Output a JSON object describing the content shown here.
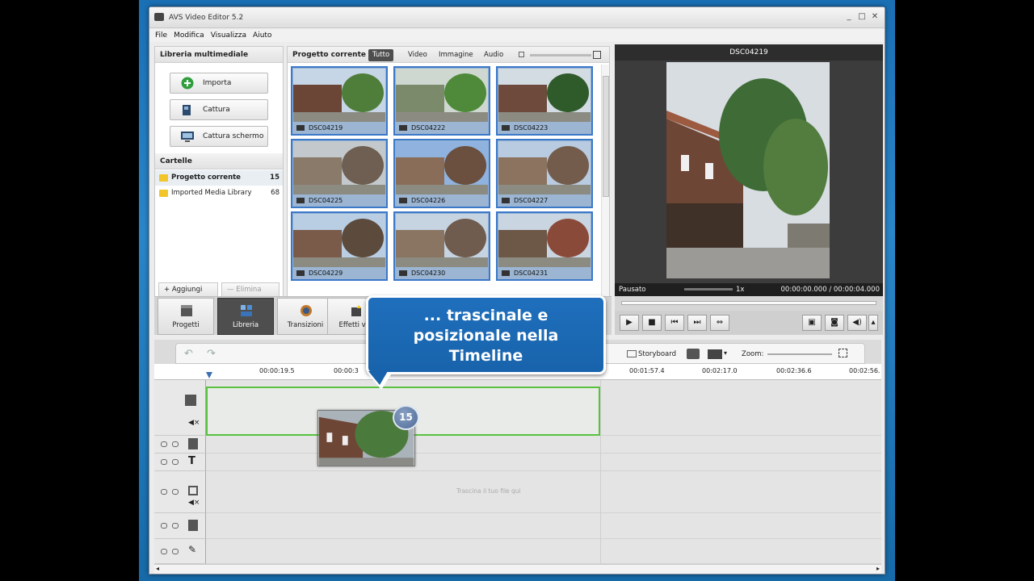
{
  "window": {
    "title": "AVS Video Editor 5.2",
    "controls": [
      "_",
      "□",
      "✕"
    ]
  },
  "menu": [
    "File",
    "Modifica",
    "Visualizza",
    "Aiuto"
  ],
  "library": {
    "title": "Libreria multimediale",
    "buttons": [
      "Importa",
      "Cattura",
      "Cattura schermo"
    ],
    "folders_title": "Cartelle",
    "folders": [
      {
        "label": "Progetto corrente",
        "count": "15"
      },
      {
        "label": "Imported Media Library",
        "count": "68"
      }
    ],
    "add_label": "+ Aggiungi",
    "remove_label": "— Elimina"
  },
  "media": {
    "title": "Progetto corrente",
    "filters": [
      "Tutto",
      "Video",
      "Immagine",
      "Audio"
    ],
    "items": [
      "DSC04219",
      "DSC04222",
      "DSC04223",
      "DSC04225",
      "DSC04226",
      "DSC04227",
      "DSC04229",
      "DSC04230",
      "DSC04231"
    ]
  },
  "preview": {
    "title": "DSC04219",
    "status": "Pausato",
    "speed": "1x",
    "time": "00:00:00.000 / 00:00:04.000"
  },
  "toolbar": [
    "Progetti",
    "Libreria",
    "Transizioni",
    "Effetti vid"
  ],
  "timeline": {
    "storyboard_label": "Storyboard",
    "zoom_label": "Zoom:",
    "ruler": [
      "00:00:19.5",
      "00:00:3",
      "00:01:57.4",
      "00:02:17.0",
      "00:02:36.6",
      "00:02:56."
    ],
    "drop_hint": "Trascina il tuo file qui",
    "drag_count": "15"
  },
  "callout": {
    "line1": "... trascinale e",
    "line2": "posizionale nella",
    "line3": "Timeline"
  },
  "colors": {
    "accent": "#1863ab",
    "drop_border": "#58c23f",
    "selection": "#3b78c8"
  }
}
